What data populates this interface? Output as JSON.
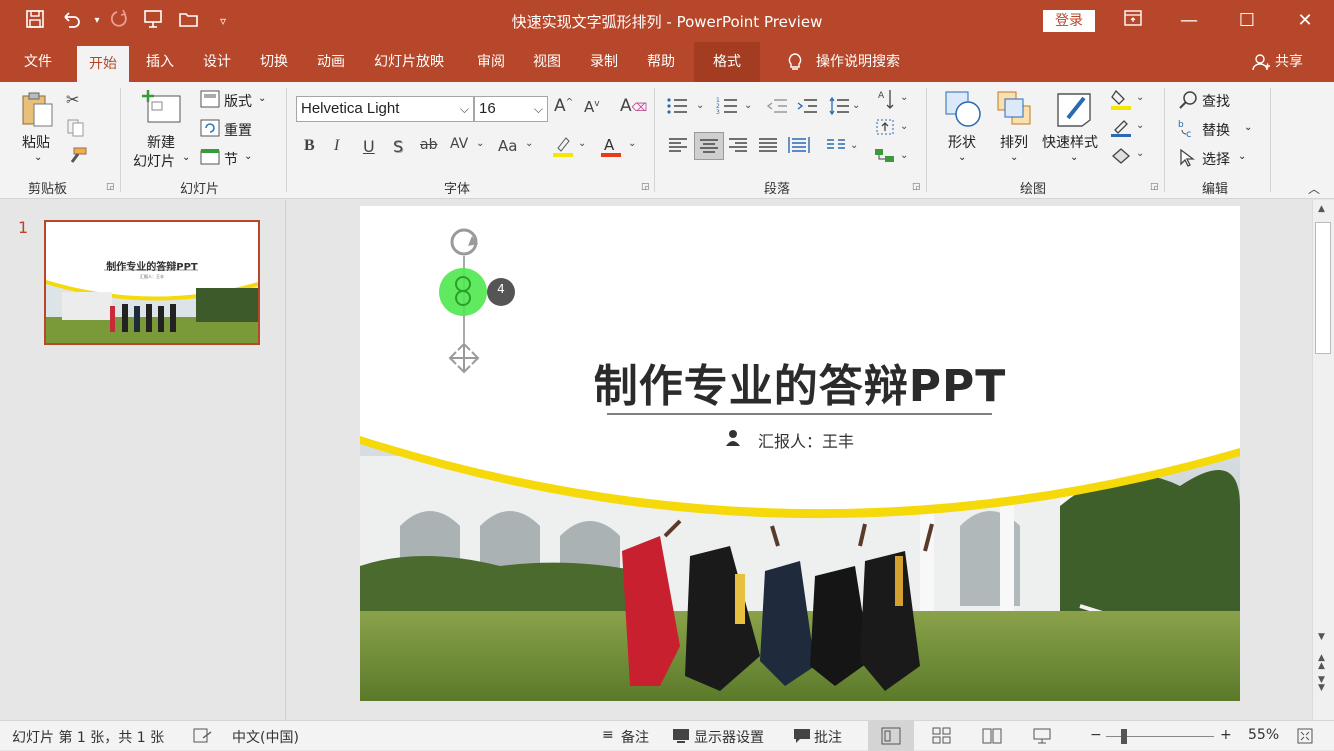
{
  "titlebar": {
    "title": "快速实现文字弧形排列 - PowerPoint Preview",
    "login": "登录"
  },
  "menu": {
    "items": [
      "文件",
      "开始",
      "插入",
      "设计",
      "切换",
      "动画",
      "幻灯片放映",
      "审阅",
      "视图",
      "录制",
      "帮助",
      "格式"
    ],
    "search": "操作说明搜索",
    "share": "共享"
  },
  "ribbon": {
    "clipboard": {
      "paste": "粘贴",
      "label": "剪贴板"
    },
    "slides": {
      "new_slide_1": "新建",
      "new_slide_2": "幻灯片",
      "layout": "版式",
      "reset": "重置",
      "section": "节",
      "label": "幻灯片"
    },
    "font": {
      "name": "Helvetica Light",
      "size": "16",
      "label": "字体",
      "case": "Aa"
    },
    "paragraph": {
      "label": "段落"
    },
    "drawing": {
      "shape": "形状",
      "arrange": "排列",
      "quick_styles": "快速样式",
      "label": "绘图"
    },
    "editing": {
      "find": "查找",
      "replace": "替换",
      "select": "选择",
      "label": "编辑"
    }
  },
  "thumbnail": {
    "number": "1",
    "title": "制作专业的答辩PPT",
    "reporter": "汇报人：王丰"
  },
  "slide": {
    "title": "制作专业的答辩PPT",
    "reporter": "汇报人：王丰",
    "shape_number": "4"
  },
  "status": {
    "slide_info": "幻灯片 第 1 张，共 1 张",
    "language": "中文(中国)",
    "notes": "备注",
    "display": "显示器设置",
    "comments": "批注",
    "zoom": "55%"
  },
  "colors": {
    "accent": "#b7472a",
    "yellow": "#f5d90a",
    "grass": "#6f8a2e"
  },
  "icons": [
    "save-icon",
    "undo-icon",
    "redo-icon",
    "present-icon",
    "open-icon",
    "customize-icon",
    "ribbon-display-icon",
    "minimize-icon",
    "maximize-icon",
    "close-icon",
    "lightbulb-icon",
    "person-icon"
  ]
}
